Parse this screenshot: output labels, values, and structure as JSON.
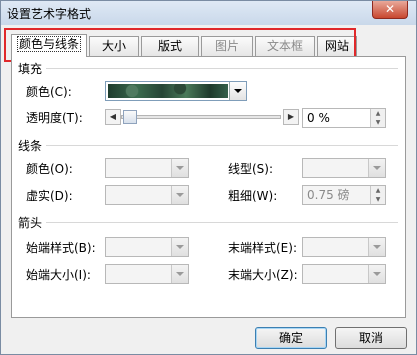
{
  "window": {
    "title": "设置艺术字格式",
    "close_glyph": "✕"
  },
  "tabs": [
    {
      "label": "颜色与线条",
      "active": true,
      "enabled": true
    },
    {
      "label": "大小",
      "active": false,
      "enabled": true
    },
    {
      "label": "版式",
      "active": false,
      "enabled": true
    },
    {
      "label": "图片",
      "active": false,
      "enabled": false
    },
    {
      "label": "文本框",
      "active": false,
      "enabled": false
    },
    {
      "label": "网站",
      "active": false,
      "enabled": true
    }
  ],
  "fill": {
    "section_label": "填充",
    "color_label": "颜色(C):",
    "color_value": "green marble texture",
    "transparency_label": "透明度(T):",
    "transparency_value": "0 %",
    "transparency_level": 0
  },
  "line": {
    "section_label": "线条",
    "color_label": "颜色(O):",
    "dash_label": "虚实(D):",
    "style_label": "线型(S):",
    "weight_label": "粗细(W):",
    "weight_value": "0.75 磅"
  },
  "arrows": {
    "section_label": "箭头",
    "begin_style_label": "始端样式(B):",
    "end_style_label": "末端样式(E):",
    "begin_size_label": "始端大小(I):",
    "end_size_label": "末端大小(Z):"
  },
  "buttons": {
    "ok": "确定",
    "cancel": "取消"
  },
  "colors": {
    "highlight_box": "#e0282a",
    "marble": "#2c4a38"
  }
}
